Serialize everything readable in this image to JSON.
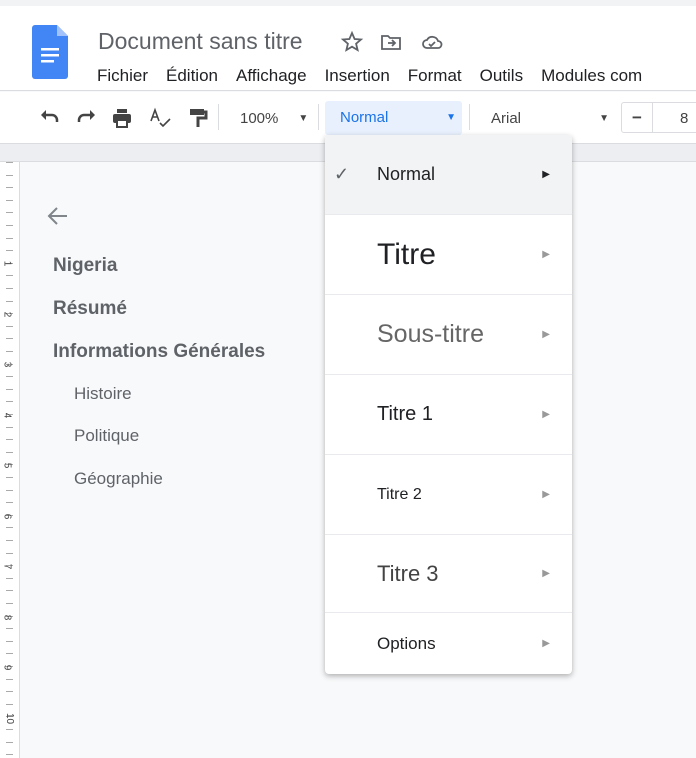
{
  "document": {
    "title": "Document sans titre"
  },
  "menubar": [
    "Fichier",
    "Édition",
    "Affichage",
    "Insertion",
    "Format",
    "Outils",
    "Modules com"
  ],
  "toolbar": {
    "zoom": "100%",
    "style": "Normal",
    "font": "Arial",
    "font_size": "8",
    "minus": "−",
    "accent": "#1a73e8"
  },
  "ruler": [
    "1",
    "2",
    "3",
    "4",
    "5",
    "6",
    "7",
    "8",
    "9",
    "10"
  ],
  "outline": {
    "items": [
      {
        "label": "Nigeria",
        "level": 1
      },
      {
        "label": "Résumé",
        "level": 1
      },
      {
        "label": "Informations Générales",
        "level": 1
      },
      {
        "label": "Histoire",
        "level": 2
      },
      {
        "label": "Politique",
        "level": 2
      },
      {
        "label": "Géographie",
        "level": 2
      }
    ]
  },
  "style_menu": {
    "items": [
      {
        "label": "Normal",
        "selected": true
      },
      {
        "label": "Titre"
      },
      {
        "label": "Sous-titre"
      },
      {
        "label": "Titre 1"
      },
      {
        "label": "Titre 2"
      },
      {
        "label": "Titre 3"
      },
      {
        "label": "Options"
      }
    ],
    "check": "✓",
    "arrow": "▶"
  }
}
